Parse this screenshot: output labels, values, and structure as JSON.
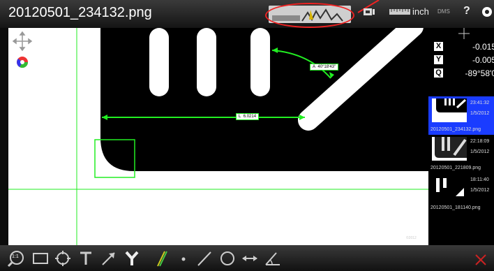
{
  "window": {
    "title": "20120501_234132.png"
  },
  "toolbar": {
    "unit_label": "inch",
    "angle_format_label": "DMS",
    "help_label": "?"
  },
  "canvas": {
    "measurements": [
      {
        "label": "A",
        "value": "40°18'43\""
      },
      {
        "label": "L",
        "value": "6.0214"
      }
    ],
    "watermark": "©2012"
  },
  "readout": {
    "x_label": "X",
    "x_value": "-0.015",
    "y_label": "Y",
    "y_value": "-0.005",
    "q_label": "Q",
    "q_value": "-89°58'0"
  },
  "thumbnails": [
    {
      "time": "23:41:32",
      "date": "1/5/2012",
      "name": "20120501_234132.png",
      "selected": true
    },
    {
      "time": "22:18:09",
      "date": "1/5/2012",
      "name": "20120501_221809.png",
      "selected": false
    },
    {
      "time": "18:11:40",
      "date": "1/5/2012",
      "name": "20120501_181140.png",
      "selected": false
    }
  ],
  "bottom_toolbar": {
    "zoom_badge": "1:1"
  },
  "colors": {
    "measure_green": "#22ee22",
    "selection_blue": "#1a3cff",
    "annotation_red": "#e22222"
  }
}
